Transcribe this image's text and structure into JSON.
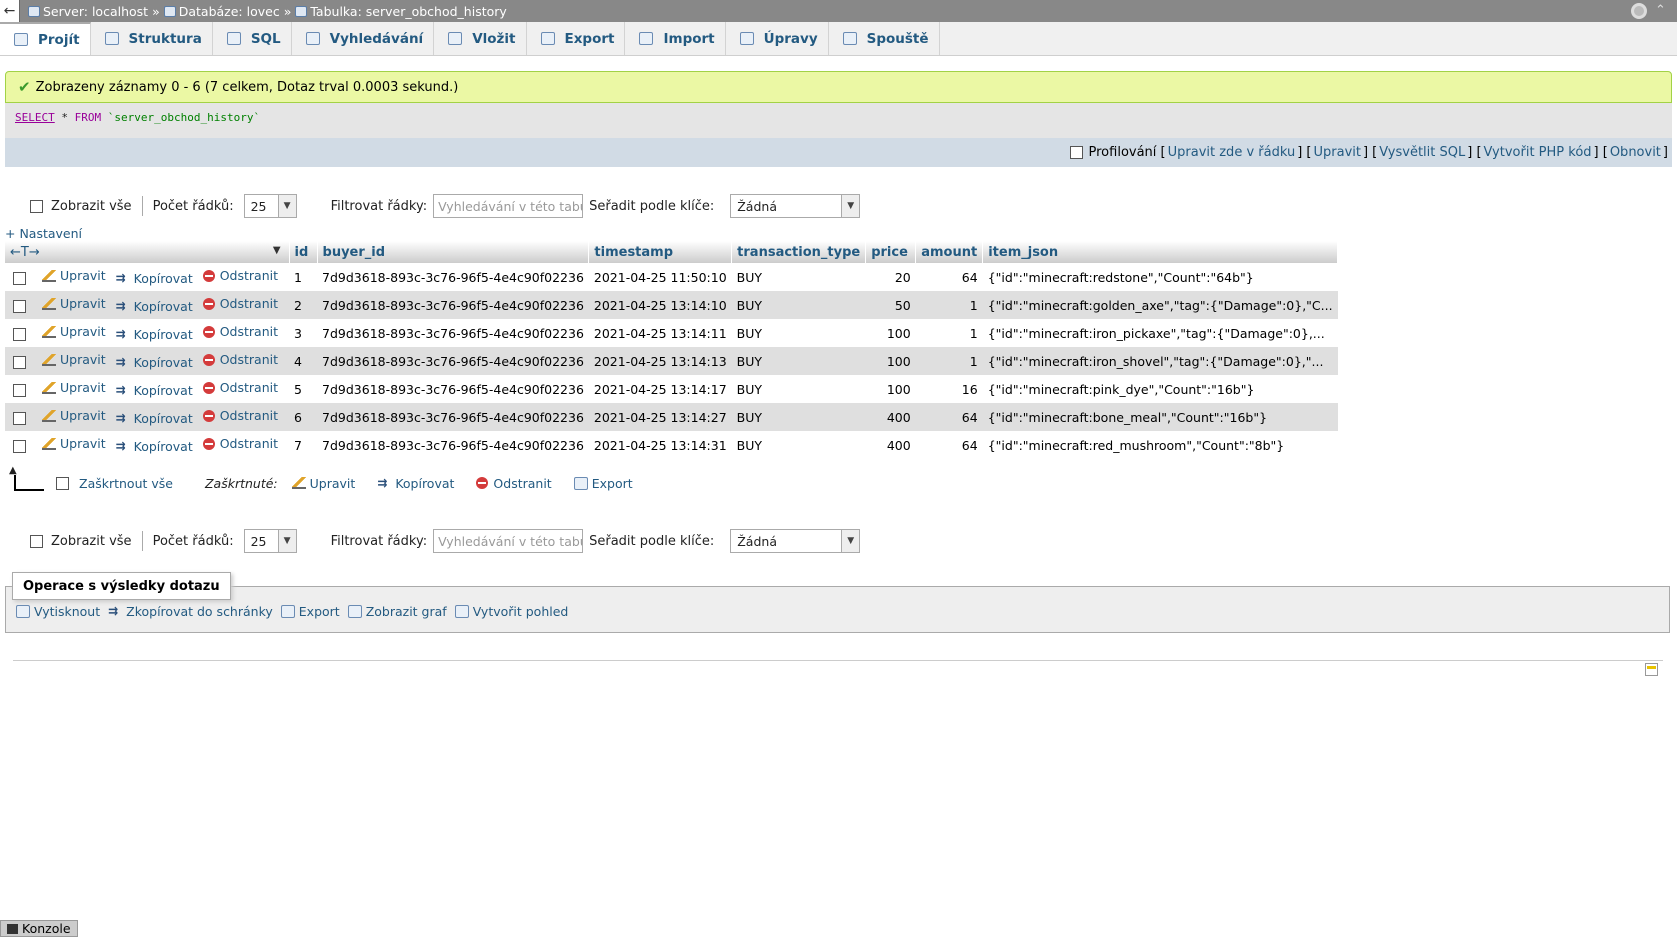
{
  "topbar": {
    "server": "Server: localhost",
    "database": "Databáze: lovec",
    "table": "Tabulka: server_obchod_history",
    "sep": "»"
  },
  "tabs": [
    {
      "label": "Projít",
      "icon": "browse-icon"
    },
    {
      "label": "Struktura",
      "icon": "structure-icon"
    },
    {
      "label": "SQL",
      "icon": "sql-icon"
    },
    {
      "label": "Vyhledávání",
      "icon": "search-icon"
    },
    {
      "label": "Vložit",
      "icon": "insert-icon"
    },
    {
      "label": "Export",
      "icon": "export-icon"
    },
    {
      "label": "Import",
      "icon": "import-icon"
    },
    {
      "label": "Úpravy",
      "icon": "wrench-icon"
    },
    {
      "label": "Spouště",
      "icon": "triggers-icon"
    }
  ],
  "message": "Zobrazeny záznamy 0 - 6 (7 celkem, Dotaz trval 0.0003 sekund.)",
  "sql": {
    "select": "SELECT",
    "star": " * ",
    "from": "FROM",
    "table": "`server_obchod_history`"
  },
  "sql_options": {
    "profiling": "Profilování",
    "edit_inline": "Upravit zde v řádku",
    "edit": "Upravit",
    "explain": "Vysvětlit SQL",
    "php": "Vytvořit PHP kód",
    "refresh": "Obnovit"
  },
  "nav": {
    "show_all": "Zobrazit vše",
    "row_count_label": "Počet řádků:",
    "row_count_value": "25",
    "filter_label": "Filtrovat řádky:",
    "filter_placeholder": "Vyhledávání v této tabulce",
    "sort_label": "Seřadit podle klíče:",
    "sort_value": "Žádná"
  },
  "settings_link": "+ Nastavení",
  "columns": [
    "id",
    "buyer_id",
    "timestamp",
    "transaction_type",
    "price",
    "amount",
    "item_json"
  ],
  "row_actions": {
    "edit": "Upravit",
    "copy": "Kopírovat",
    "delete": "Odstranit"
  },
  "rows": [
    {
      "id": "1",
      "buyer_id": "7d9d3618-893c-3c76-96f5-4e4c90f02236",
      "timestamp": "2021-04-25 11:50:10",
      "type": "BUY",
      "price": "20",
      "amount": "64",
      "item": "{\"id\":\"minecraft:redstone\",\"Count\":\"64b\"}"
    },
    {
      "id": "2",
      "buyer_id": "7d9d3618-893c-3c76-96f5-4e4c90f02236",
      "timestamp": "2021-04-25 13:14:10",
      "type": "BUY",
      "price": "50",
      "amount": "1",
      "item": "{\"id\":\"minecraft:golden_axe\",\"tag\":{\"Damage\":0},\"C..."
    },
    {
      "id": "3",
      "buyer_id": "7d9d3618-893c-3c76-96f5-4e4c90f02236",
      "timestamp": "2021-04-25 13:14:11",
      "type": "BUY",
      "price": "100",
      "amount": "1",
      "item": "{\"id\":\"minecraft:iron_pickaxe\",\"tag\":{\"Damage\":0},..."
    },
    {
      "id": "4",
      "buyer_id": "7d9d3618-893c-3c76-96f5-4e4c90f02236",
      "timestamp": "2021-04-25 13:14:13",
      "type": "BUY",
      "price": "100",
      "amount": "1",
      "item": "{\"id\":\"minecraft:iron_shovel\",\"tag\":{\"Damage\":0},\"..."
    },
    {
      "id": "5",
      "buyer_id": "7d9d3618-893c-3c76-96f5-4e4c90f02236",
      "timestamp": "2021-04-25 13:14:17",
      "type": "BUY",
      "price": "100",
      "amount": "16",
      "item": "{\"id\":\"minecraft:pink_dye\",\"Count\":\"16b\"}"
    },
    {
      "id": "6",
      "buyer_id": "7d9d3618-893c-3c76-96f5-4e4c90f02236",
      "timestamp": "2021-04-25 13:14:27",
      "type": "BUY",
      "price": "400",
      "amount": "64",
      "item": "{\"id\":\"minecraft:bone_meal\",\"Count\":\"16b\"}"
    },
    {
      "id": "7",
      "buyer_id": "7d9d3618-893c-3c76-96f5-4e4c90f02236",
      "timestamp": "2021-04-25 13:14:31",
      "type": "BUY",
      "price": "400",
      "amount": "64",
      "item": "{\"id\":\"minecraft:red_mushroom\",\"Count\":\"8b\"}"
    }
  ],
  "bulk": {
    "check_all": "Zaškrtnout vše",
    "checked_label": "Zaškrtnuté:",
    "edit": "Upravit",
    "copy": "Kopírovat",
    "delete": "Odstranit",
    "export": "Export"
  },
  "ops": {
    "legend": "Operace s výsledky dotazu",
    "print": "Vytisknout",
    "clipboard": "Zkopírovat do schránky",
    "export": "Export",
    "chart": "Zobrazit graf",
    "view": "Vytvořit pohled"
  },
  "console": "Konzole"
}
